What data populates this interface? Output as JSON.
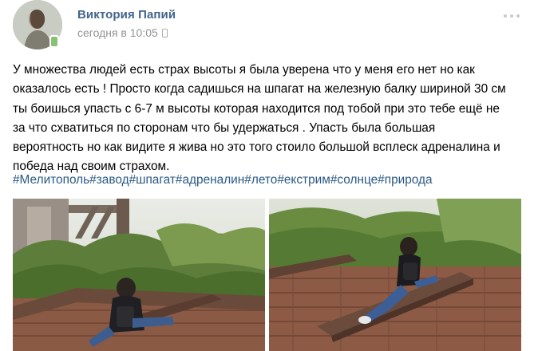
{
  "post": {
    "author": "Виктория Папий",
    "time": "сегодня в 10:05",
    "text": "У множества людей есть страх высоты я была уверена что у меня его нет но как оказалось есть ! Просто когда садишься на шпагат на железную балку шириной 30 см ты боишься упасть с 6-7 м высоты которая находится под тобой при это тебе ещё не за что схватиться по сторонам что бы удержаться . Упасть была большая вероятность но как видите я жива но это того стоило большой всплеск адреналина и победа над своим страхом.",
    "hashtags": [
      "#Мелитополь",
      "#завод",
      "#шпагат",
      "#адреналин",
      "#лето",
      "#екстрим",
      "#солнце",
      "#природа"
    ]
  },
  "icons": {
    "online_status": "mobile-online-icon",
    "device": "phone-icon",
    "menu": "more-dots-icon"
  },
  "colors": {
    "author_link": "#42648b",
    "hashtag_link": "#2a5885",
    "meta_text": "#939393",
    "online_green": "#8ac176"
  }
}
